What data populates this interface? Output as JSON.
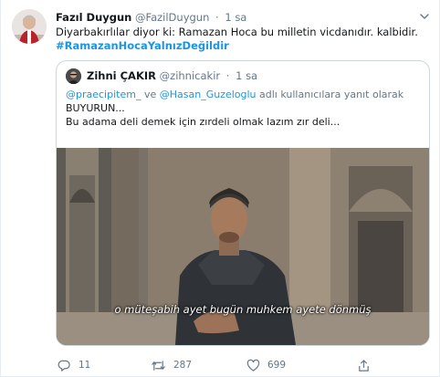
{
  "tweet": {
    "author_name": "Fazıl Duygun",
    "author_handle": "@FazilDuygun",
    "separator": "·",
    "time": "1 sa",
    "text_line1": "Diyarbakırlılar diyor ki: Ramazan Hoca bu milletin vicdanıdır. kalbidir.",
    "hashtag": "#RamazanHocaYalnızDeğildir"
  },
  "quote": {
    "author_name": "Zihni ÇAKIR",
    "author_handle": "@zihnicakir",
    "separator": "·",
    "time": "1 sa",
    "reply_mention1": "@praecipitem_",
    "reply_and": " ve ",
    "reply_mention2": "@Hasan_Guzeloglu",
    "reply_suffix": " adlı kullanıcılara yanıt olarak",
    "text_line1": "BUYURUN...",
    "text_line2": "Bu adama deli demek için zırdeli olmak lazım zır deli...",
    "video_subtitle": "o müteşabih ayet bugün muhkem ayete dönmüş"
  },
  "actions": {
    "reply_count": "11",
    "retweet_count": "287",
    "like_count": "699"
  },
  "icons": {
    "caret": "chevron-down-icon",
    "reply": "reply-icon",
    "retweet": "retweet-icon",
    "like": "heart-icon",
    "share": "share-icon"
  },
  "colors": {
    "link": "#1b95e0",
    "secondary_text": "#657786",
    "border": "#e6ecf0"
  }
}
